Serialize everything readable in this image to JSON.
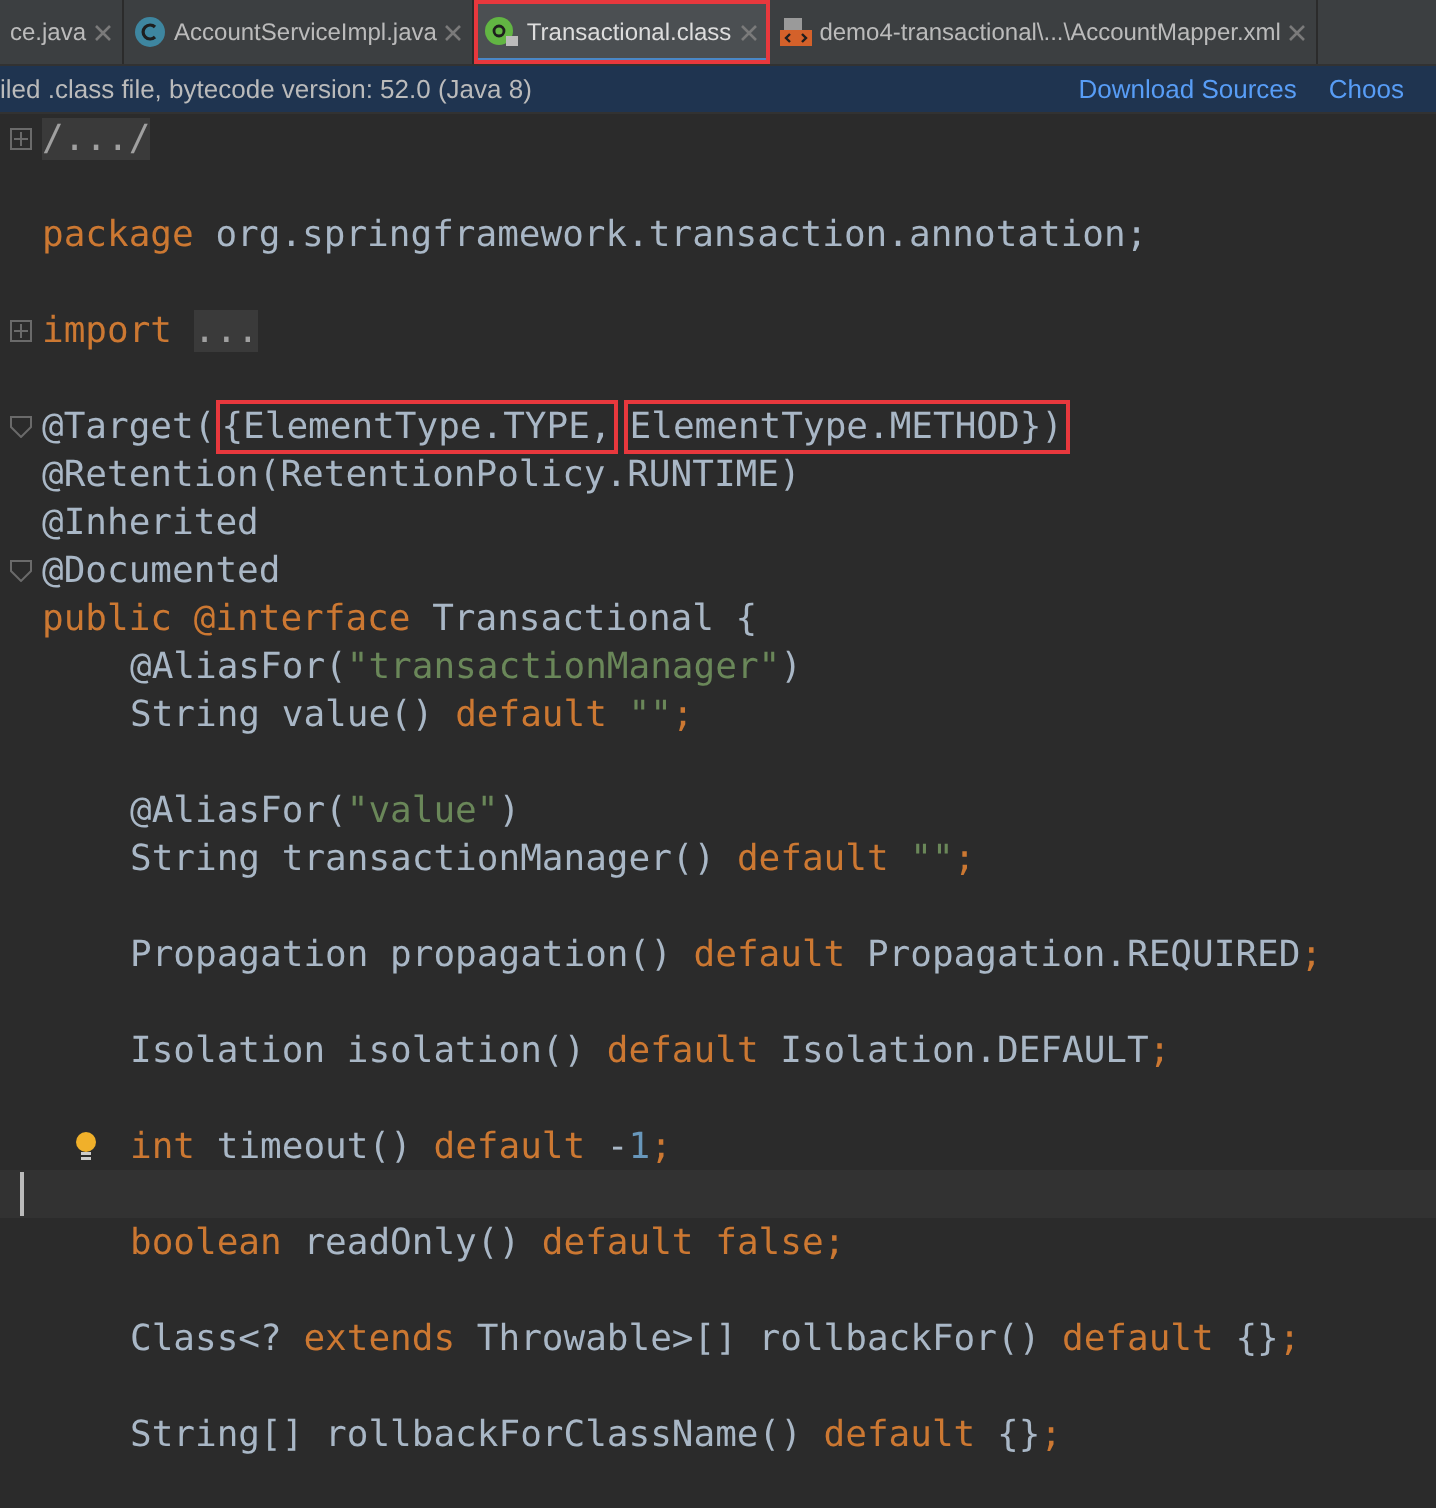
{
  "tabs": [
    {
      "label": "ce.java",
      "kind": "plain",
      "selected": false,
      "highlighted": false
    },
    {
      "label": "AccountServiceImpl.java",
      "kind": "class",
      "selected": false,
      "highlighted": false
    },
    {
      "label": "Transactional.class",
      "kind": "annotation",
      "selected": true,
      "highlighted": true
    },
    {
      "label": "demo4-transactional\\...\\AccountMapper.xml",
      "kind": "xml",
      "selected": false,
      "highlighted": false
    }
  ],
  "info_bar": {
    "message": "iled .class file, bytecode version: 52.0 (Java 8)",
    "links": [
      "Download Sources",
      "Choos"
    ]
  },
  "code_lines": [
    {
      "kind": "fold-plus",
      "tokens": [
        {
          "kind": "folded",
          "text": "/.../"
        }
      ]
    },
    {
      "kind": "blank"
    },
    {
      "kind": "plain",
      "tokens": [
        {
          "kind": "keyword",
          "text": "package"
        },
        {
          "kind": "plain",
          "text": " org.springframework.transaction.annotation;"
        }
      ]
    },
    {
      "kind": "blank"
    },
    {
      "kind": "fold-plus",
      "tokens": [
        {
          "kind": "keyword",
          "text": "import "
        },
        {
          "kind": "folded",
          "text": "..."
        }
      ]
    },
    {
      "kind": "blank"
    },
    {
      "kind": "fold-minus",
      "tokens": [
        {
          "kind": "plain",
          "text": "@Target("
        },
        {
          "kind": "boxed",
          "text": "{ElementType.TYPE,"
        },
        {
          "kind": "boxed",
          "text": "ElementType.METHOD})"
        }
      ]
    },
    {
      "kind": "plain",
      "tokens": [
        {
          "kind": "plain",
          "text": "@Retention(RetentionPolicy.RUNTIME)"
        }
      ]
    },
    {
      "kind": "plain",
      "tokens": [
        {
          "kind": "plain",
          "text": "@Inherited"
        }
      ]
    },
    {
      "kind": "fold-minus",
      "tokens": [
        {
          "kind": "plain",
          "text": "@Documented"
        }
      ]
    },
    {
      "kind": "plain",
      "tokens": [
        {
          "kind": "keyword",
          "text": "public @interface"
        },
        {
          "kind": "plain",
          "text": " Transactional {"
        }
      ],
      "children": [
        {
          "kind": "plain",
          "tokens": [
            {
              "kind": "plain",
              "text": "@AliasFor("
            },
            {
              "kind": "string",
              "text": "\"transactionManager\""
            },
            {
              "kind": "plain",
              "text": ")"
            }
          ]
        },
        {
          "kind": "plain",
          "tokens": [
            {
              "kind": "plain",
              "text": "String value() "
            },
            {
              "kind": "keyword",
              "text": "default "
            },
            {
              "kind": "string",
              "text": "\"\""
            },
            {
              "kind": "keyword",
              "text": ";"
            }
          ]
        },
        {
          "kind": "blank"
        },
        {
          "kind": "plain",
          "tokens": [
            {
              "kind": "plain",
              "text": "@AliasFor("
            },
            {
              "kind": "string",
              "text": "\"value\""
            },
            {
              "kind": "plain",
              "text": ")"
            }
          ]
        },
        {
          "kind": "plain",
          "tokens": [
            {
              "kind": "plain",
              "text": "String transactionManager() "
            },
            {
              "kind": "keyword",
              "text": "default "
            },
            {
              "kind": "string",
              "text": "\"\""
            },
            {
              "kind": "keyword",
              "text": ";"
            }
          ]
        },
        {
          "kind": "blank"
        },
        {
          "kind": "plain",
          "tokens": [
            {
              "kind": "plain",
              "text": "Propagation propagation() "
            },
            {
              "kind": "keyword",
              "text": "default"
            },
            {
              "kind": "plain",
              "text": " Propagation.REQUIRED"
            },
            {
              "kind": "keyword",
              "text": ";"
            }
          ]
        },
        {
          "kind": "blank"
        },
        {
          "kind": "plain",
          "tokens": [
            {
              "kind": "plain",
              "text": "Isolation isolation() "
            },
            {
              "kind": "keyword",
              "text": "default"
            },
            {
              "kind": "plain",
              "text": " Isolation.DEFAULT"
            },
            {
              "kind": "keyword",
              "text": ";"
            }
          ]
        },
        {
          "kind": "blank"
        },
        {
          "kind": "bulb",
          "tokens": [
            {
              "kind": "keyword",
              "text": "int"
            },
            {
              "kind": "plain",
              "text": " timeout() "
            },
            {
              "kind": "keyword",
              "text": "default"
            },
            {
              "kind": "plain",
              "text": " -"
            },
            {
              "kind": "number",
              "text": "1"
            },
            {
              "kind": "keyword",
              "text": ";"
            }
          ]
        },
        {
          "kind": "caret"
        },
        {
          "kind": "plain",
          "tokens": [
            {
              "kind": "keyword",
              "text": "boolean"
            },
            {
              "kind": "plain",
              "text": " readOnly() "
            },
            {
              "kind": "keyword",
              "text": "default false;"
            }
          ]
        },
        {
          "kind": "blank"
        },
        {
          "kind": "plain",
          "tokens": [
            {
              "kind": "plain",
              "text": "Class<? "
            },
            {
              "kind": "keyword",
              "text": "extends"
            },
            {
              "kind": "plain",
              "text": " Throwable>[] rollbackFor() "
            },
            {
              "kind": "keyword",
              "text": "default"
            },
            {
              "kind": "plain",
              "text": " {}"
            },
            {
              "kind": "keyword",
              "text": ";"
            }
          ]
        },
        {
          "kind": "blank"
        },
        {
          "kind": "plain",
          "tokens": [
            {
              "kind": "plain",
              "text": "String[] rollbackForClassName() "
            },
            {
              "kind": "keyword",
              "text": "default"
            },
            {
              "kind": "plain",
              "text": " {}"
            },
            {
              "kind": "keyword",
              "text": ";"
            }
          ]
        }
      ]
    }
  ]
}
